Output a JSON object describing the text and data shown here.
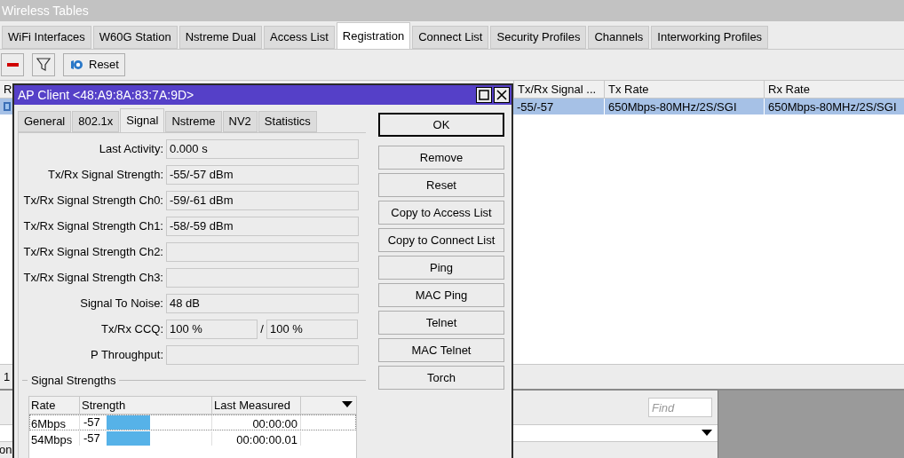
{
  "window": {
    "title": "Wireless Tables"
  },
  "tabs": [
    {
      "label": "WiFi Interfaces",
      "selected": false
    },
    {
      "label": "W60G Station",
      "selected": false
    },
    {
      "label": "Nstreme Dual",
      "selected": false
    },
    {
      "label": "Access List",
      "selected": false
    },
    {
      "label": "Registration",
      "selected": true
    },
    {
      "label": "Connect List",
      "selected": false
    },
    {
      "label": "Security Profiles",
      "selected": false
    },
    {
      "label": "Channels",
      "selected": false
    },
    {
      "label": "Interworking Profiles",
      "selected": false
    }
  ],
  "toolbar": {
    "reset_label": "Reset"
  },
  "table": {
    "columns": [
      "R",
      "Tx/Rx Signal ...",
      "Tx Rate",
      "Rx Rate"
    ],
    "rows": [
      {
        "selected": true,
        "cells": [
          "",
          "-55/-57",
          "650Mbps-80MHz/2S/SGI",
          "650Mbps-80MHz/2S/SGI"
        ]
      }
    ],
    "status": "1"
  },
  "lower_pane": {
    "find_placeholder": "Find",
    "cut_text": "on"
  },
  "dialog": {
    "title": "AP Client <48:A9:8A:83:7A:9D>",
    "tabs": [
      {
        "label": "General",
        "selected": false
      },
      {
        "label": "802.1x",
        "selected": false
      },
      {
        "label": "Signal",
        "selected": true
      },
      {
        "label": "Nstreme",
        "selected": false
      },
      {
        "label": "NV2",
        "selected": false
      },
      {
        "label": "Statistics",
        "selected": false
      }
    ],
    "fields": [
      {
        "kind": "single",
        "label": "Last Activity:",
        "value": "0.000 s"
      },
      {
        "kind": "single",
        "label": "Tx/Rx Signal Strength:",
        "value": "-55/-57 dBm"
      },
      {
        "kind": "single",
        "label": "Tx/Rx Signal Strength Ch0:",
        "value": "-59/-61 dBm"
      },
      {
        "kind": "single",
        "label": "Tx/Rx Signal Strength Ch1:",
        "value": "-58/-59 dBm"
      },
      {
        "kind": "single",
        "label": "Tx/Rx Signal Strength Ch2:"
      },
      {
        "kind": "single",
        "label": "Tx/Rx Signal Strength Ch3:"
      },
      {
        "kind": "single",
        "label": "Signal To Noise:",
        "value": "48 dB"
      },
      {
        "kind": "pair",
        "label": "Tx/Rx CCQ:",
        "value": "100 %",
        "separator": "/",
        "value2": "100 %"
      },
      {
        "kind": "single",
        "label": "P Throughput:"
      }
    ],
    "buttons": [
      {
        "label": "OK",
        "default": true
      },
      {
        "label": "Remove",
        "default": false
      },
      {
        "label": "Reset",
        "default": false
      },
      {
        "label": "Copy to Access List",
        "default": false
      },
      {
        "label": "Copy to Connect List",
        "default": false
      },
      {
        "label": "Ping",
        "default": false
      },
      {
        "label": "MAC Ping",
        "default": false
      },
      {
        "label": "Telnet",
        "default": false
      },
      {
        "label": "MAC Telnet",
        "default": false
      },
      {
        "label": "Torch",
        "default": false
      }
    ],
    "signal_group": {
      "title": "Signal Strengths",
      "columns": [
        "Rate",
        "Strength",
        "Last Measured"
      ],
      "rows": [
        {
          "rate": "6Mbps",
          "strength": "-57",
          "level": 0.42,
          "last_measured": "00:00:00"
        },
        {
          "rate": "54Mbps",
          "strength": "-57",
          "level": 0.42,
          "last_measured": "00:00:00.01"
        }
      ]
    }
  }
}
